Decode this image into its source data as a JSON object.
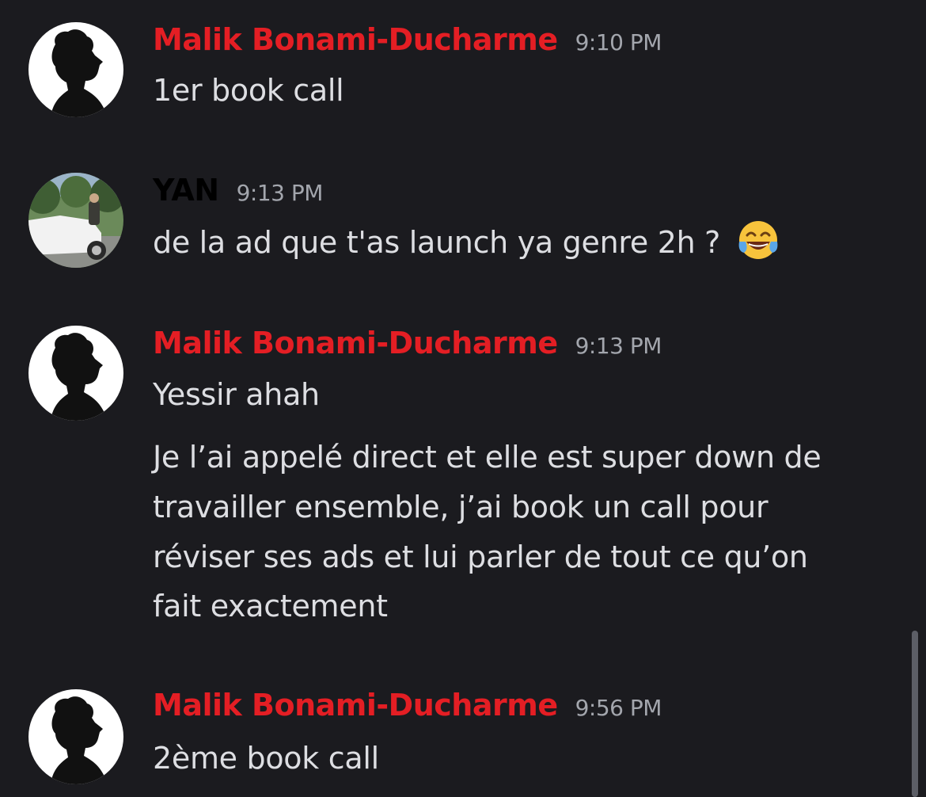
{
  "colors": {
    "background": "#1b1b1f",
    "malik_name": "#e41e24",
    "yan_name": "#000000",
    "timestamp": "#a3a6ad",
    "message_text": "#dddee2"
  },
  "messages": [
    {
      "author": "Malik Bonami-Ducharme",
      "time": "9:10 PM",
      "lines": [
        "1er book call"
      ]
    },
    {
      "author": "YAN",
      "time": "9:13 PM",
      "lines": [
        "de la ad que t'as launch ya genre 2h ? "
      ],
      "emoji": "tears-of-joy-emoji"
    },
    {
      "author": "Malik Bonami-Ducharme",
      "time": "9:13 PM",
      "lines": [
        "Yessir ahah",
        "Je l’ai appelé direct et elle est super down de",
        "travailler ensemble, j’ai book un call pour",
        "réviser ses ads et lui parler de tout ce qu’on",
        "fait exactement"
      ]
    },
    {
      "author": "Malik Bonami-Ducharme",
      "time": "9:56 PM",
      "lines": [
        "2ème book call"
      ]
    }
  ]
}
